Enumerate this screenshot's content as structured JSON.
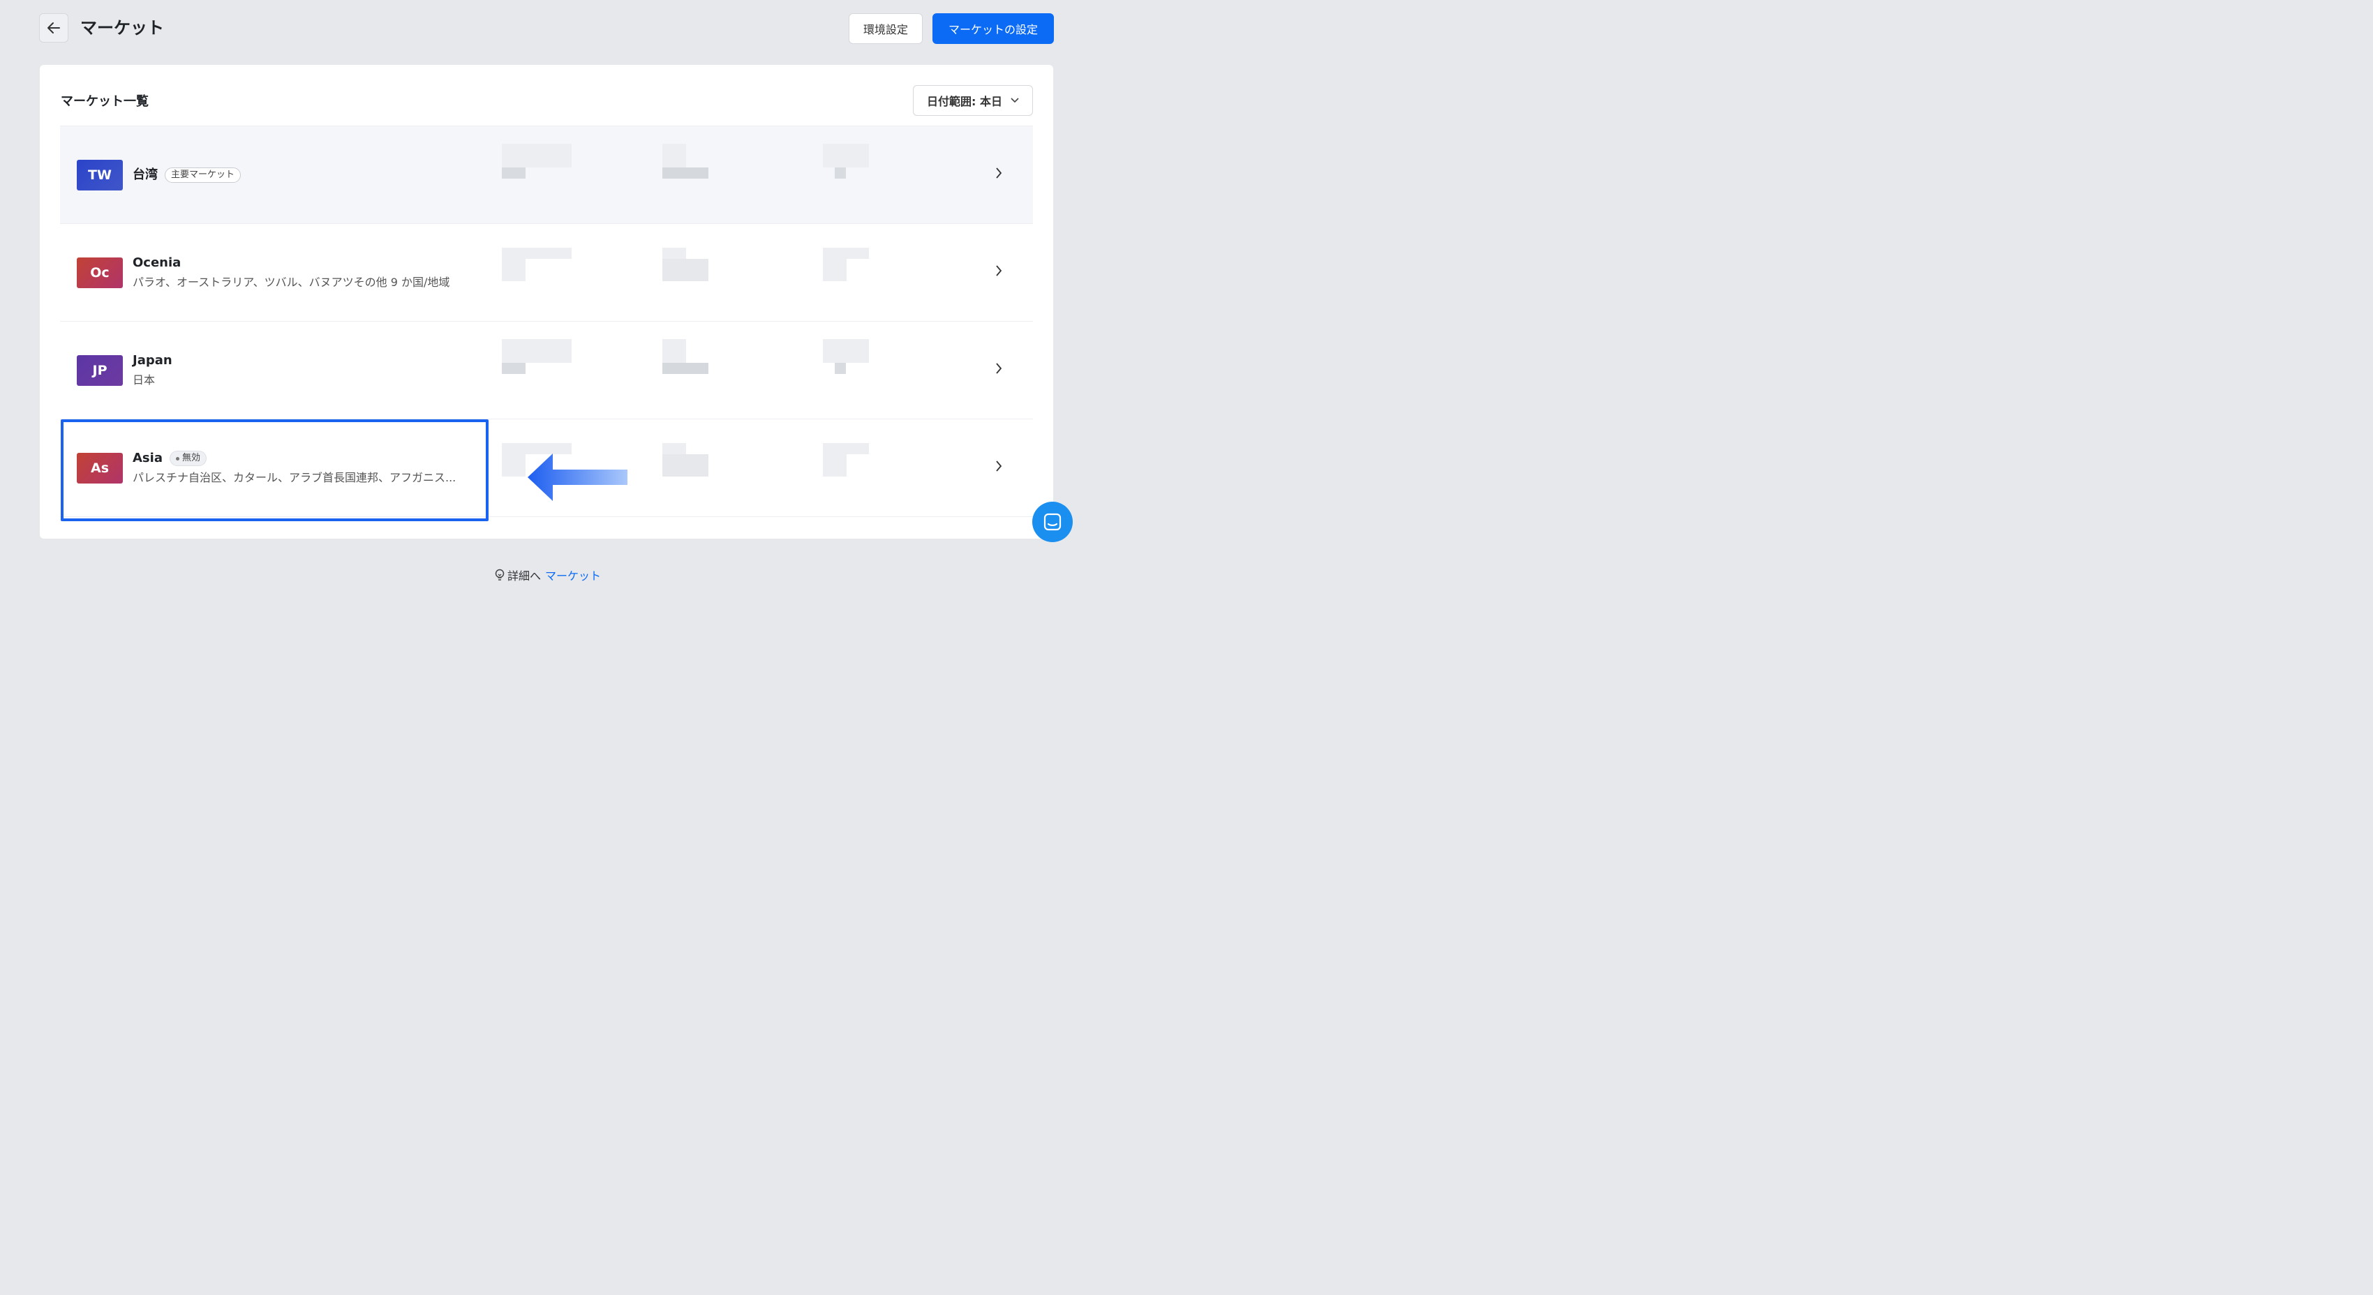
{
  "header": {
    "title": "マーケット",
    "settings_button": "環境設定",
    "primary_button": "マーケットの設定"
  },
  "list_section": {
    "title": "マーケット一覧",
    "date_range": "日付範囲: 本日"
  },
  "markets": [
    {
      "code": "TW",
      "name": "台湾",
      "badge": "主要マーケット",
      "description": "",
      "avatar_color": "#2d48c7"
    },
    {
      "code": "Oc",
      "name": "Ocenia",
      "badge": "",
      "description": "パラオ、オーストラリア、ツバル、バヌアツその他 9 か国/地域",
      "avatar_color": "#c23f45"
    },
    {
      "code": "JP",
      "name": "Japan",
      "badge": "",
      "description": "日本",
      "avatar_color": "#5a3aa8"
    },
    {
      "code": "As",
      "name": "Asia",
      "badge": "無効",
      "description": "パレスチナ自治区、カタール、アラブ首長国連邦、アフガニス...",
      "avatar_color": "#c23f45"
    }
  ],
  "footer": {
    "prefix": "詳細へ",
    "link": "マーケット"
  },
  "colors": {
    "primary": "#0b6bf5",
    "highlight_frame": "#1a62f0",
    "chat_button": "#1b8ff0"
  },
  "icons": [
    "arrow-left-icon",
    "chevron-down-icon",
    "chevron-right-icon",
    "lightbulb-icon",
    "chat-icon"
  ]
}
